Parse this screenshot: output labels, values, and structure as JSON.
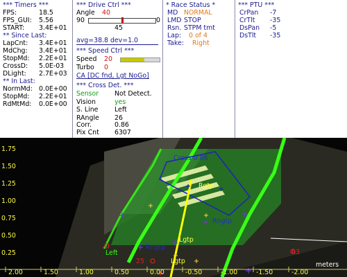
{
  "timers": {
    "header": "*** Timers ***",
    "fps_label": "FPS:",
    "fps_value": "18.5",
    "fpsgui_label": "FPS_GUI:",
    "fpsgui_value": "5.56",
    "start_label": "START:",
    "start_value": "3.4E+01",
    "since_last_header": "** Since Last:",
    "lapcnt_label": "LapCnt:",
    "lapcnt_value": "3.4E+01",
    "mdchg_label": "MdChg:",
    "mdchg_value": "3.4E+01",
    "stopmd_label": "StopMd:",
    "stopmd_value": "2.2E+01",
    "crossd_label": "CrossD:",
    "crossd_value": "5.0E-03",
    "dlight_label": "DLight:",
    "dlight_value": "2.7E+03",
    "in_last_header": "** In Last:",
    "normmd_label": "NormMd:",
    "normmd_value": "0.0E+00",
    "stopmd2_label": "StopMd:",
    "stopmd2_value": "2.2E+01",
    "rdmtmd_label": "RdMtMd:",
    "rdmtmd_value": "0.0E+00"
  },
  "drive_ctrl": {
    "header": "*** Drive Ctrl ***",
    "angle_label": "Angle",
    "angle_value": "40",
    "slider_min": "90",
    "slider_max": "0",
    "slider_value": "45",
    "slider_fraction": 0.5,
    "avg_text": "avg=38.8 dev=1.0"
  },
  "speed_ctrl": {
    "header": "*** Speed Ctrl ***",
    "speed_label": "Speed",
    "speed_value": "20",
    "speed_fraction": 0.6,
    "turbo_label": "Turbo",
    "turbo_value": "0",
    "ca_link": "CA [DC fnd, Lgt NoGo]"
  },
  "cross_det": {
    "header": "*** Cross Det. ***",
    "sensor_label": "Sensor",
    "sensor_value": "Not Detect.",
    "vision_label": "Vision",
    "vision_value": "yes",
    "sline_label": "S. Line",
    "sline_value": "Left",
    "rangle_label": "RAngle",
    "rangle_value": "26",
    "corr_label": "Corr.",
    "corr_value": "0.86",
    "pixcnt_label": "Pix Cnt",
    "pixcnt_value": "6307"
  },
  "race_status": {
    "header": "* Race Status *",
    "md_label": "MD",
    "md_value": "NORMAL",
    "lmd_label": "LMD",
    "lmd_value": "STOP",
    "rsn_label": "Rsn.",
    "rsn_value": "STPM tmt",
    "lap_label": "Lap:",
    "lap_value": "0 of 4",
    "take_label": "Take:",
    "take_value": "Right"
  },
  "ptu": {
    "header": "*** PTU ***",
    "crpan_label": "CrPan",
    "crpan_value": "-7",
    "crtilt_label": "CrTlt",
    "crtilt_value": "-35",
    "dspan_label": "DsPan",
    "dspan_value": "-5",
    "dstilt_label": "DsTlt",
    "dstilt_value": "-35"
  },
  "camera_view": {
    "y_ticks": [
      "1.75",
      "1.50",
      "1.25",
      "1.00",
      "0.75",
      "0.50",
      "0.25"
    ],
    "x_ticks": [
      "2.00",
      "1.50",
      "1.00",
      "0.50",
      "0.00",
      "-0.50",
      "-1.00",
      "-1.50",
      "-2.00"
    ],
    "axis_unit": "meters",
    "labels": {
      "cross": "Cross 0.86",
      "rgtp": "Rgtp",
      "rngtp": "Rngtp",
      "left": "Left",
      "rngtp_left": "Rngtp",
      "lgtp": "Lgtp",
      "lgtp2": "Lgtp",
      "num_25": "25",
      "num_63": "63"
    },
    "colors": {
      "track": "#1e8a1e",
      "edge": "#39ff14",
      "yellow": "#ffff00",
      "blue": "#2020c0",
      "red": "#e02020",
      "purple": "#6a3ad0"
    }
  }
}
